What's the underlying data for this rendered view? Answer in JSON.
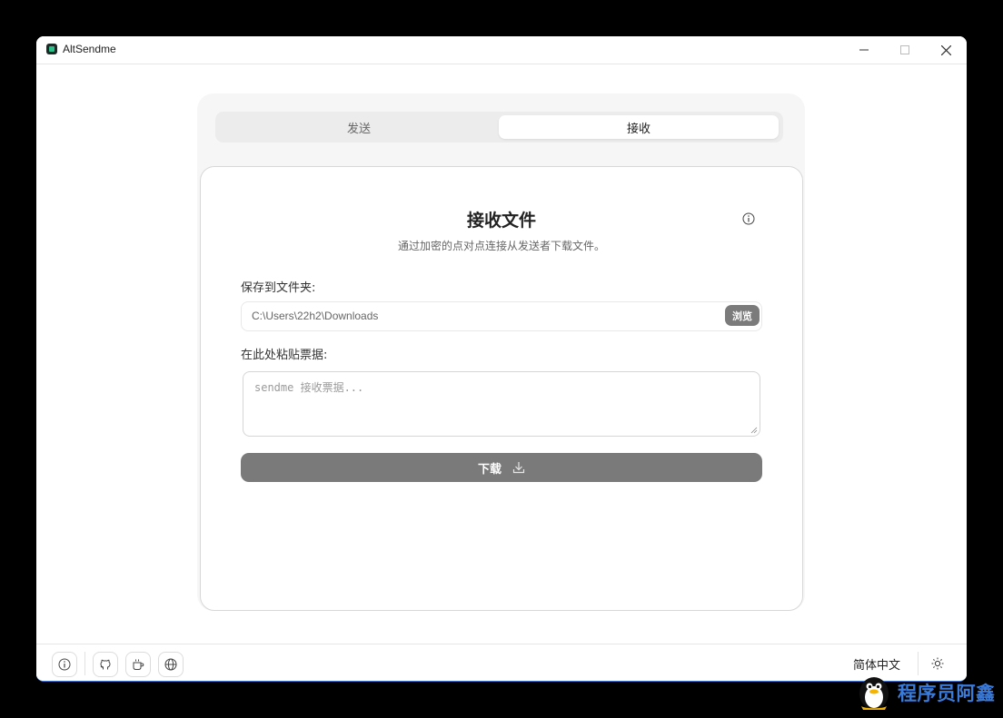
{
  "window": {
    "title": "AltSendme"
  },
  "tabs": [
    {
      "label": "发送",
      "active": false
    },
    {
      "label": "接收",
      "active": true
    }
  ],
  "card": {
    "title": "接收文件",
    "subtitle": "通过加密的点对点连接从发送者下载文件。",
    "folder_label": "保存到文件夹:",
    "folder_path": "C:\\Users\\22h2\\Downloads",
    "browse_label": "浏览",
    "ticket_label": "在此处粘贴票据:",
    "ticket_placeholder": "sendme 接收票据...",
    "download_label": "下载"
  },
  "footer": {
    "language": "简体中文"
  },
  "watermark": {
    "text": "程序员阿鑫"
  },
  "colors": {
    "button_gray": "#7a7a7a",
    "accent_blue": "#3a7bd9"
  },
  "icons": [
    "app-icon",
    "minimize-icon",
    "maximize-icon",
    "close-icon",
    "info-icon",
    "download-icon",
    "github-icon",
    "coffee-icon",
    "globe-icon",
    "sun-icon"
  ]
}
